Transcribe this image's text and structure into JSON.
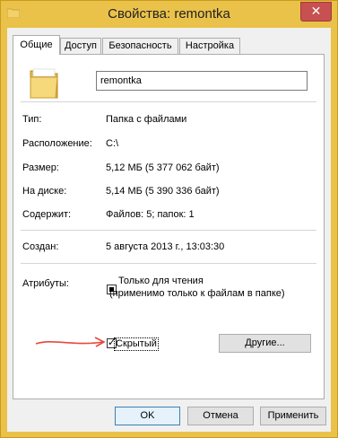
{
  "window": {
    "title": "Свойства: remontka",
    "close_glyph": "✕"
  },
  "tabs": [
    {
      "label": "Общие",
      "active": true
    },
    {
      "label": "Доступ",
      "active": false
    },
    {
      "label": "Безопасность",
      "active": false
    },
    {
      "label": "Настройка",
      "active": false
    }
  ],
  "general": {
    "name_value": "remontka",
    "rows": [
      {
        "label": "Тип:",
        "value": "Папка с файлами"
      },
      {
        "label": "Расположение:",
        "value": "C:\\"
      },
      {
        "label": "Размер:",
        "value": "5,12 МБ (5 377 062 байт)"
      },
      {
        "label": "На диске:",
        "value": "5,14 МБ (5 390 336 байт)"
      },
      {
        "label": "Содержит:",
        "value": "Файлов: 5; папок: 1"
      }
    ],
    "created_label": "Создан:",
    "created_value": "5 августа 2013 г., 13:03:30",
    "attributes_label": "Атрибуты:",
    "readonly_label_line1": "Только для чтения",
    "readonly_label_line2": "(применимо только к файлам в папке)",
    "readonly_state": "indeterminate",
    "hidden_label": "Скрытый",
    "hidden_checked": true,
    "other_button": "Другие..."
  },
  "footer": {
    "ok": "OK",
    "cancel": "Отмена",
    "apply": "Применить"
  },
  "colors": {
    "frame": "#eac24a",
    "close": "#c75050",
    "annotation_arrow": "#e8483c",
    "folder_yellow": "#f2d16b"
  }
}
